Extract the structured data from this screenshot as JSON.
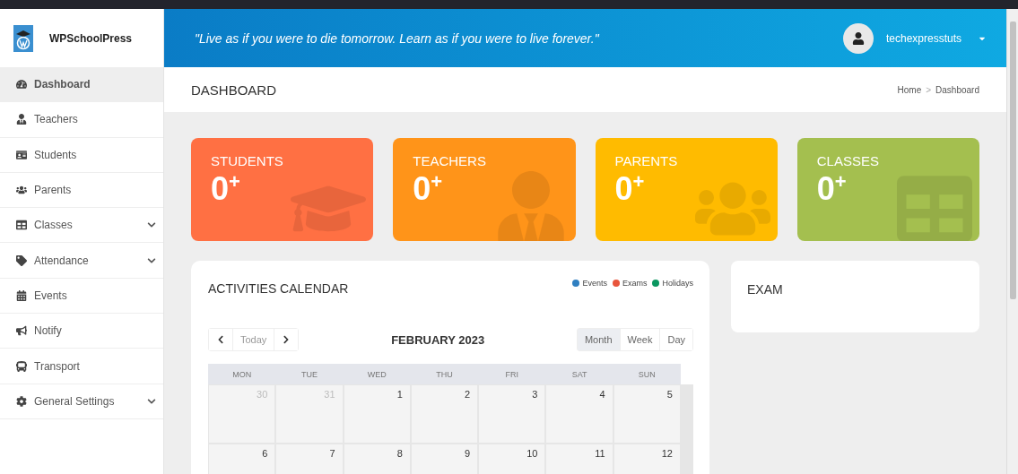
{
  "brand": {
    "name": "WPSchoolPress"
  },
  "sidebar": {
    "items": [
      {
        "label": "Dashboard",
        "selected": true,
        "expandable": false
      },
      {
        "label": "Teachers",
        "selected": false,
        "expandable": false
      },
      {
        "label": "Students",
        "selected": false,
        "expandable": false
      },
      {
        "label": "Parents",
        "selected": false,
        "expandable": false
      },
      {
        "label": "Classes",
        "selected": false,
        "expandable": true
      },
      {
        "label": "Attendance",
        "selected": false,
        "expandable": true
      },
      {
        "label": "Events",
        "selected": false,
        "expandable": false
      },
      {
        "label": "Notify",
        "selected": false,
        "expandable": false
      },
      {
        "label": "Transport",
        "selected": false,
        "expandable": false
      },
      {
        "label": "General Settings",
        "selected": false,
        "expandable": true
      }
    ]
  },
  "header": {
    "quote": "\"Live as if you were to die tomorrow. Learn as if you were to live forever.\"",
    "user": "techexpresstuts"
  },
  "page": {
    "title": "DASHBOARD",
    "breadcrumb": [
      "Home",
      "Dashboard"
    ],
    "breadcrumb_separator": ">"
  },
  "stats": [
    {
      "label": "STUDENTS",
      "count": "0$^{+}$",
      "color": "#ff7043"
    },
    {
      "label": "TEACHERS",
      "count": "0$^{+}$",
      "color": "#ff9419"
    },
    {
      "label": "PARENTS",
      "count": "0$^{+}$",
      "color": "#ffbb00"
    },
    {
      "label": "CLASSES",
      "count": "0$^{+}$",
      "color": "#a4bf4f"
    }
  ],
  "calendar": {
    "title": "ACTIVITIES CALENDAR",
    "legend": [
      {
        "label": "Events",
        "color": "#2f7fc1"
      },
      {
        "label": "Exams",
        "color": "#e8553c"
      },
      {
        "label": "Holidays",
        "color": "#0b9760"
      }
    ],
    "today": "Today",
    "month": "FEBRUARY 2023",
    "views": [
      {
        "label": "Month",
        "selected": true
      },
      {
        "label": "Week",
        "selected": false
      },
      {
        "label": "Day",
        "selected": false
      }
    ],
    "weekdays": [
      "MON",
      "TUE",
      "WED",
      "THU",
      "FRI",
      "SAT",
      "SUN"
    ],
    "weeks": [
      [
        {
          "day": "30",
          "other_month": true
        },
        {
          "day": "31",
          "other_month": true
        },
        {
          "day": "1",
          "other_month": false
        },
        {
          "day": "2",
          "other_month": false
        },
        {
          "day": "3",
          "other_month": false
        },
        {
          "day": "4",
          "other_month": false
        },
        {
          "day": "5",
          "other_month": false
        }
      ],
      [
        {
          "day": "6",
          "other_month": false
        },
        {
          "day": "7",
          "other_month": false
        },
        {
          "day": "8",
          "other_month": false
        },
        {
          "day": "9",
          "other_month": false
        },
        {
          "day": "10",
          "other_month": false
        },
        {
          "day": "11",
          "other_month": false
        },
        {
          "day": "12",
          "other_month": false
        }
      ]
    ]
  },
  "exam": {
    "title": "EXAM"
  }
}
